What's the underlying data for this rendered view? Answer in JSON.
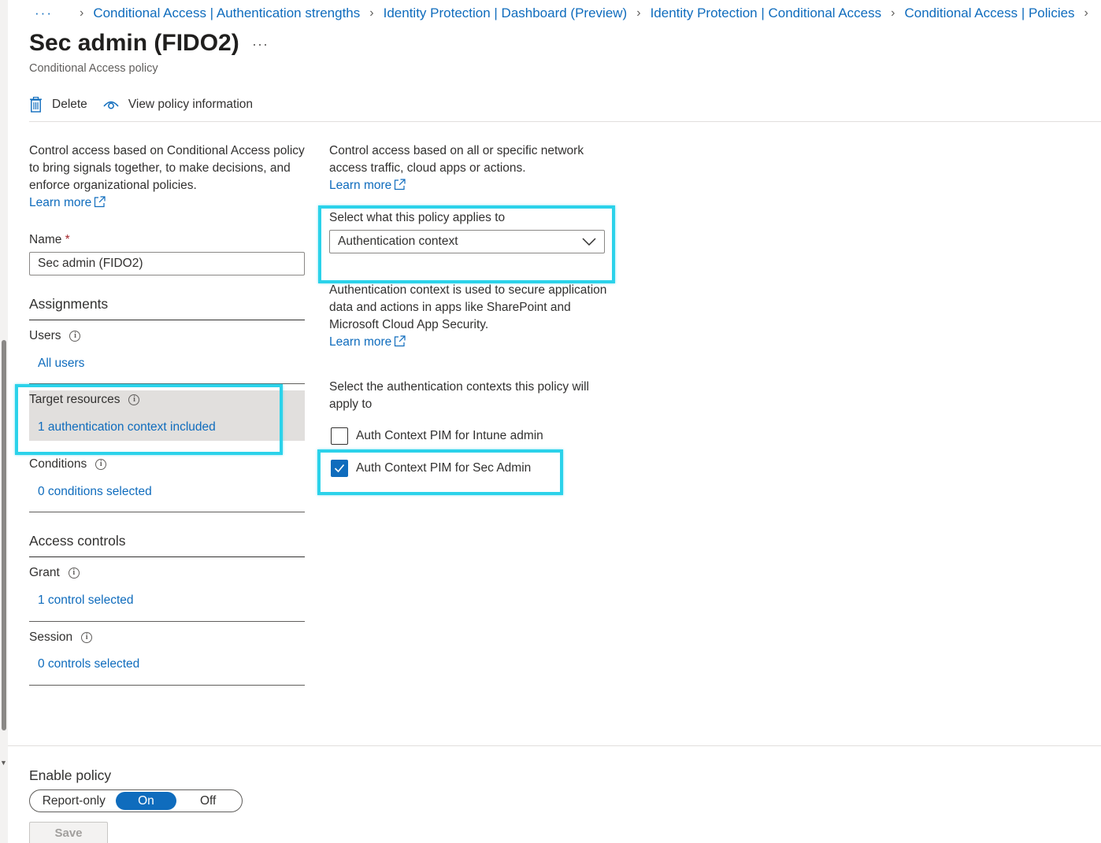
{
  "breadcrumb": {
    "overflow": "···",
    "items": [
      "Conditional Access | Authentication strengths",
      "Identity Protection | Dashboard (Preview)",
      "Identity Protection | Conditional Access",
      "Conditional Access | Policies"
    ]
  },
  "header": {
    "title": "Sec admin (FIDO2)",
    "more": "···",
    "subtitle": "Conditional Access policy"
  },
  "toolbar": {
    "delete_label": "Delete",
    "view_info_label": "View policy information"
  },
  "left": {
    "description": "Control access based on Conditional Access policy to bring signals together, to make decisions, and enforce organizational policies.",
    "learn_more": "Learn more",
    "name_label": "Name",
    "required_mark": "*",
    "name_value": "Sec admin (FIDO2)",
    "assignments_heading": "Assignments",
    "users_label": "Users",
    "users_value": "All users",
    "target_label": "Target resources",
    "target_value": "1 authentication context included",
    "conditions_label": "Conditions",
    "conditions_value": "0 conditions selected",
    "access_heading": "Access controls",
    "grant_label": "Grant",
    "grant_value": "1 control selected",
    "session_label": "Session",
    "session_value": "0 controls selected"
  },
  "right": {
    "description": "Control access based on all or specific network access traffic, cloud apps or actions.",
    "learn_more": "Learn more",
    "applies_label": "Select what this policy applies to",
    "applies_value": "Authentication context",
    "ctx_description": "Authentication context is used to secure application data and actions in apps like SharePoint and Microsoft Cloud App Security.",
    "ctx_learn_more": "Learn more",
    "select_ctx_label": "Select the authentication contexts this policy will apply to",
    "contexts": [
      {
        "label": "Auth Context PIM for Intune admin",
        "checked": false
      },
      {
        "label": "Auth Context PIM for Sec Admin",
        "checked": true
      }
    ]
  },
  "footer": {
    "enable_label": "Enable policy",
    "options": [
      "Report-only",
      "On",
      "Off"
    ],
    "selected_option": "On",
    "save_label": "Save"
  },
  "colors": {
    "accent": "#0f6cbd",
    "highlight": "#2bd2ea"
  }
}
